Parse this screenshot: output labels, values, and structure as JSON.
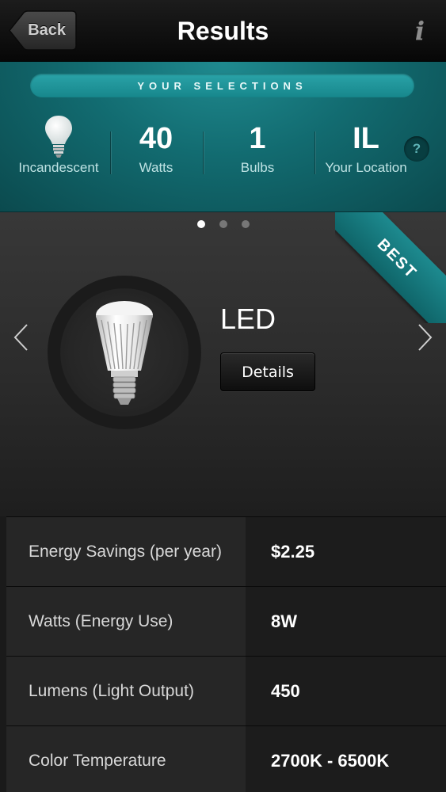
{
  "nav": {
    "back_label": "Back",
    "title": "Results",
    "info_glyph": "i"
  },
  "selections": {
    "header": "YOUR SELECTIONS",
    "bulb_type": {
      "label": "Incandescent",
      "icon": "lightbulb-icon"
    },
    "watts": {
      "value": "40",
      "label": "Watts"
    },
    "bulbs": {
      "value": "1",
      "label": "Bulbs"
    },
    "location": {
      "value": "IL",
      "label": "Your Location"
    },
    "help_glyph": "?"
  },
  "carousel": {
    "page_count": 3,
    "active_page": 1,
    "badge": "BEST",
    "product_name": "LED",
    "details_label": "Details"
  },
  "specs": [
    {
      "label": "Energy Savings (per year)",
      "value": "$2.25"
    },
    {
      "label": "Watts (Energy Use)",
      "value": "8W"
    },
    {
      "label": "Lumens (Light Output)",
      "value": "450"
    },
    {
      "label": "Color Temperature",
      "value": "2700K - 6500K"
    }
  ],
  "colors": {
    "accent_teal": "#1d8a8f",
    "background_dark": "#1a1a1a"
  }
}
